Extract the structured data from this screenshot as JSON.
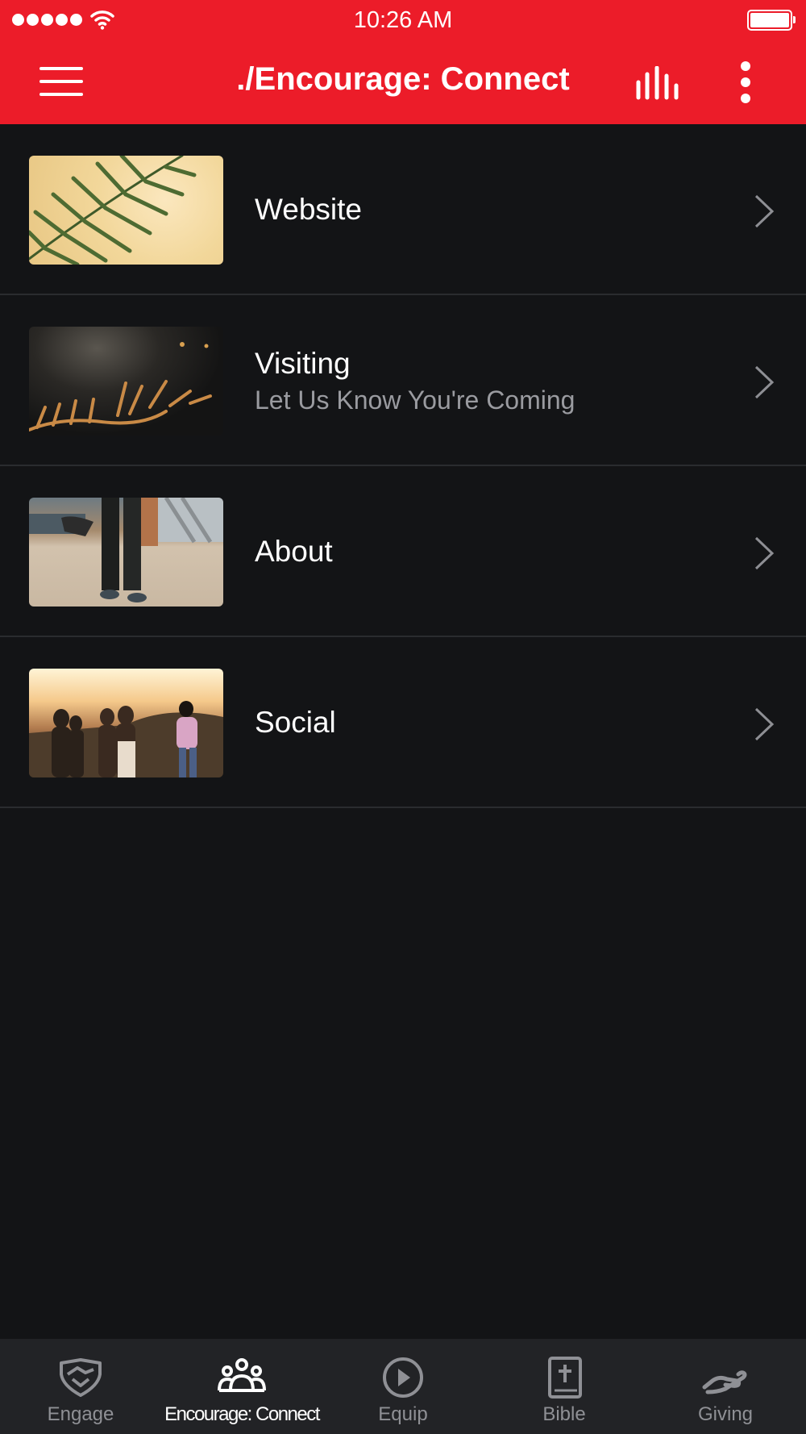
{
  "status_bar": {
    "time": "10:26 AM"
  },
  "app_bar": {
    "title": "./Encourage: Connect",
    "background_color": "#ec1c29",
    "menu_icon": "hamburger-menu-icon",
    "stats_icon": "audio-bars-icon",
    "more_icon": "more-vertical-icon"
  },
  "list": {
    "items": [
      {
        "title": "Website",
        "subtitle": "",
        "thumbnail": "palm-leaf-photo"
      },
      {
        "title": "Visiting",
        "subtitle": "Let Us Know You're Coming",
        "thumbnail": "concert-hands-photo"
      },
      {
        "title": "About",
        "subtitle": "",
        "thumbnail": "beach-legs-photo"
      },
      {
        "title": "Social",
        "subtitle": "",
        "thumbnail": "friends-sunset-photo"
      }
    ]
  },
  "tab_bar": {
    "active_index": 1,
    "tabs": [
      {
        "label": "Engage",
        "icon": "handshake-shield-icon"
      },
      {
        "label": "Encourage: Connect",
        "icon": "group-people-icon"
      },
      {
        "label": "Equip",
        "icon": "play-circle-icon"
      },
      {
        "label": "Bible",
        "icon": "bible-book-icon"
      },
      {
        "label": "Giving",
        "icon": "giving-hand-icon"
      }
    ]
  }
}
